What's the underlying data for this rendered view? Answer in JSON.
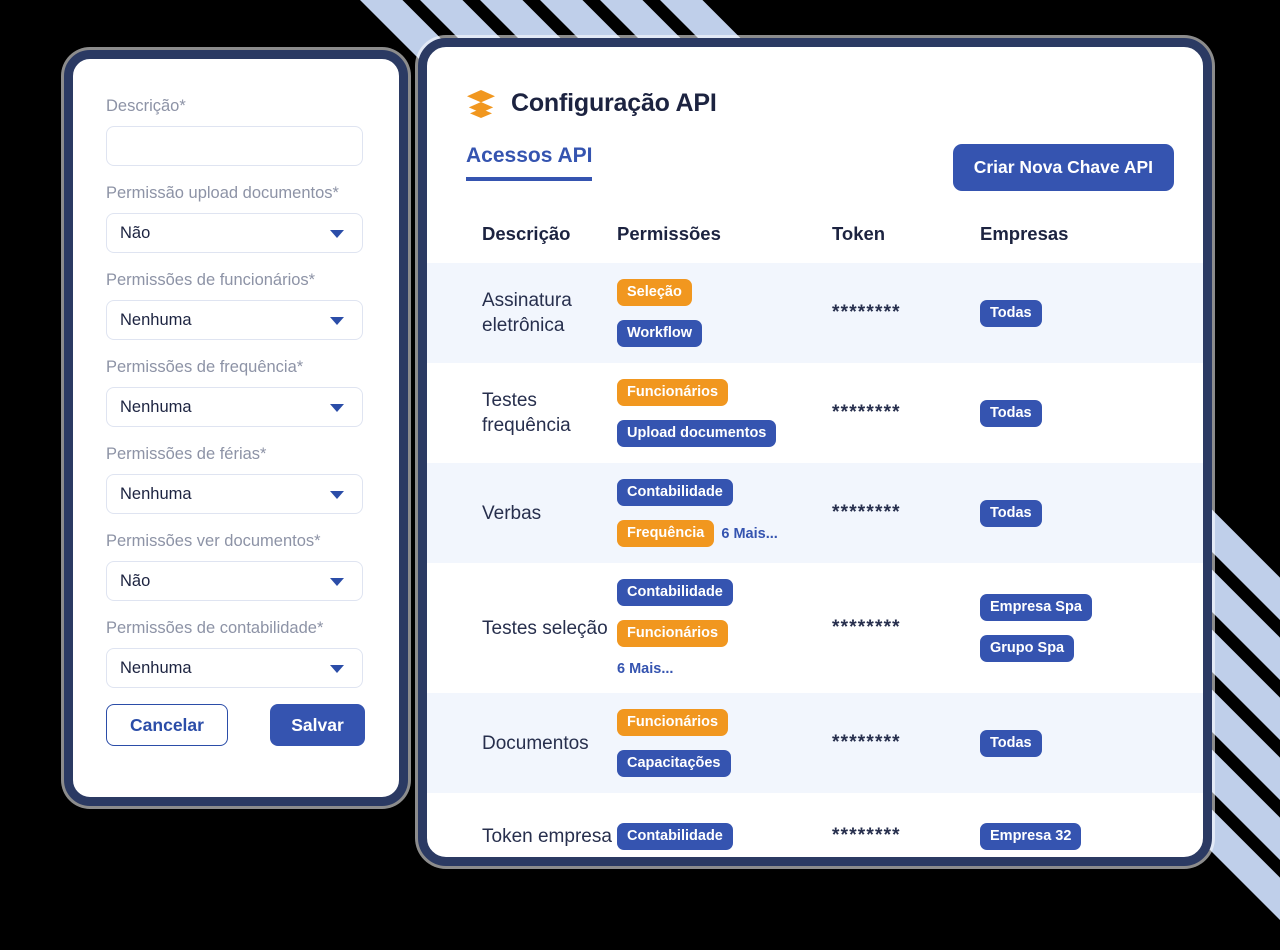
{
  "form": {
    "fields": [
      {
        "label": "Descrição*",
        "type": "input",
        "value": ""
      },
      {
        "label": "Permissão upload documentos*",
        "type": "select",
        "value": "Não"
      },
      {
        "label": "Permissões de funcionários*",
        "type": "select",
        "value": "Nenhuma"
      },
      {
        "label": "Permissões de frequência*",
        "type": "select",
        "value": "Nenhuma"
      },
      {
        "label": "Permissões de férias*",
        "type": "select",
        "value": "Nenhuma"
      },
      {
        "label": "Permissões ver documentos*",
        "type": "select",
        "value": "Não"
      },
      {
        "label": "Permissões de contabilidade*",
        "type": "select",
        "value": "Nenhuma"
      }
    ],
    "cancel_label": "Cancelar",
    "save_label": "Salvar"
  },
  "api": {
    "icon": "stack-icon",
    "title": "Configuração API",
    "tab_label": "Acessos API",
    "create_button_label": "Criar Nova Chave API",
    "columns": [
      "Descrição",
      "Permissões",
      "Token",
      "Empresas"
    ],
    "rows": [
      {
        "description": "Assinatura eletrônica",
        "permissions": [
          {
            "label": "Seleção",
            "color": "orange"
          },
          {
            "label": "Workflow",
            "color": "blue"
          }
        ],
        "more": "",
        "more_inline": false,
        "token": "********",
        "companies": [
          "Todas"
        ],
        "shaded": true
      },
      {
        "description": "Testes frequência",
        "permissions": [
          {
            "label": "Funcionários",
            "color": "orange"
          },
          {
            "label": "Upload documentos",
            "color": "blue"
          }
        ],
        "more": "",
        "more_inline": false,
        "token": "********",
        "companies": [
          "Todas"
        ],
        "shaded": false
      },
      {
        "description": "Verbas",
        "permissions": [
          {
            "label": "Contabilidade",
            "color": "blue"
          },
          {
            "label": "Frequência",
            "color": "orange"
          }
        ],
        "more": "6 Mais...",
        "more_inline": true,
        "token": "********",
        "companies": [
          "Todas"
        ],
        "shaded": true
      },
      {
        "description": "Testes seleção",
        "permissions": [
          {
            "label": "Contabilidade",
            "color": "blue"
          },
          {
            "label": "Funcionários",
            "color": "orange"
          }
        ],
        "more": "6 Mais...",
        "more_inline": false,
        "token": "********",
        "companies": [
          "Empresa Spa",
          "Grupo Spa"
        ],
        "shaded": false
      },
      {
        "description": "Documentos",
        "permissions": [
          {
            "label": "Funcionários",
            "color": "orange"
          },
          {
            "label": "Capacitações",
            "color": "blue"
          }
        ],
        "more": "",
        "more_inline": false,
        "token": "********",
        "companies": [
          "Todas"
        ],
        "shaded": true
      },
      {
        "description": "Token empresa",
        "permissions": [
          {
            "label": "Contabilidade",
            "color": "blue"
          }
        ],
        "more": "",
        "more_inline": false,
        "token": "********",
        "companies": [
          "Empresa 32"
        ],
        "shaded": false
      }
    ]
  },
  "colors": {
    "background": "#000000",
    "card_border": "#2b3a63",
    "accent_blue": "#3554b0",
    "accent_orange": "#f1971f",
    "stripe": "#bfcfea",
    "row_shade": "#f2f6fd",
    "label_gray": "#8d93a6",
    "text_dark": "#1c2340"
  }
}
